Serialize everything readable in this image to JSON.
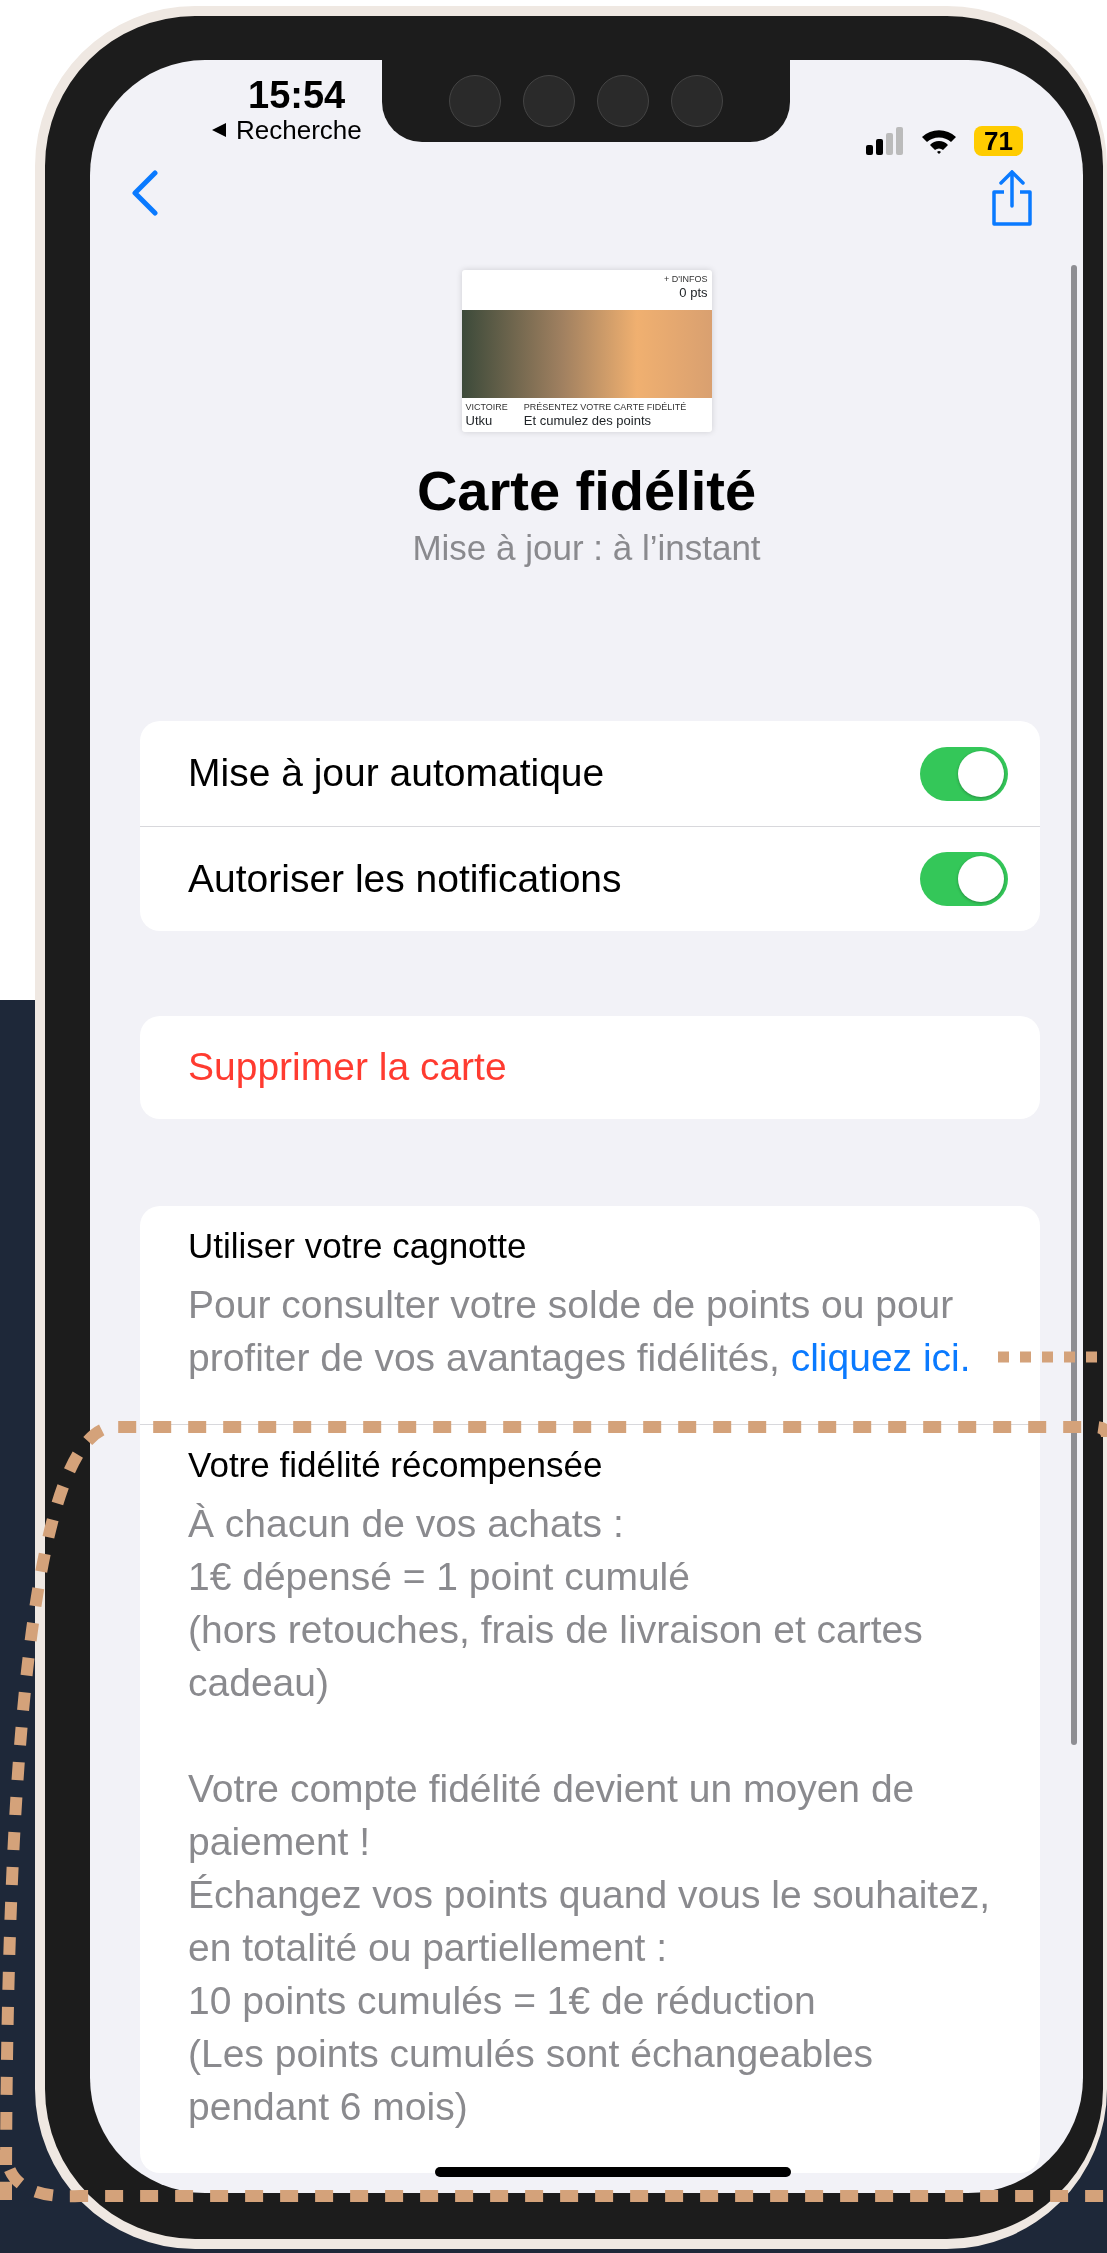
{
  "status_bar": {
    "time": "15:54",
    "back_app": "Recherche",
    "battery": "71"
  },
  "pass_preview": {
    "corner_label": "+ D'INFOS",
    "points": "0 pts",
    "fields": [
      {
        "label": "VICTOIRE",
        "value": "Utku"
      },
      {
        "label": "PRÉSENTEZ VOTRE CARTE FIDÉLITÉ",
        "value": "Et cumulez des points"
      }
    ]
  },
  "title": "Carte fidélité",
  "subtitle": "Mise à jour : à l’instant",
  "settings": [
    {
      "label": "Mise à jour automatique",
      "on": true
    },
    {
      "label": "Autoriser les notifications",
      "on": true
    }
  ],
  "delete_button": "Supprimer la carte",
  "info_sections": [
    {
      "heading": "Utiliser votre cagnotte",
      "paragraphs": [
        {
          "text": "Pour consulter votre solde de points ou pour profiter de vos avantages fidélités, ",
          "link": "cliquez ici."
        }
      ]
    },
    {
      "heading": "Votre fidélité récompensée",
      "paragraphs": [
        {
          "lines": [
            "À chacun de vos achats :",
            "1€ dépensé = 1 point cumulé",
            "(hors retouches, frais de livraison et cartes cadeau)"
          ]
        },
        {
          "lines": [
            "Votre compte fidélité devient un moyen de paiement !",
            "Échangez vos points quand vous le souhaitez, en totalité ou partiellement :",
            "10 points cumulés = 1€ de réduction",
            "(Les points cumulés sont échangeables pendant 6 mois)"
          ]
        }
      ]
    }
  ]
}
